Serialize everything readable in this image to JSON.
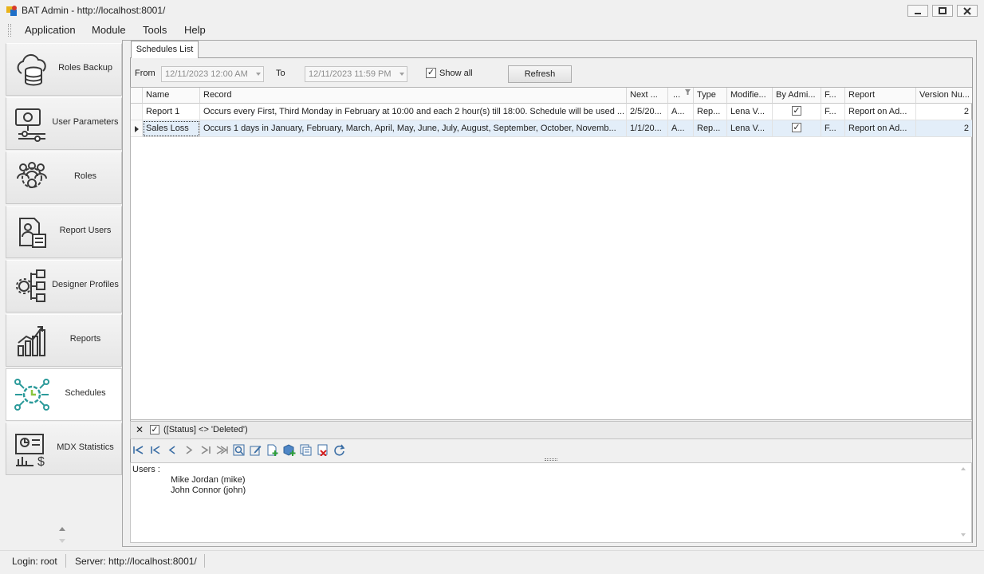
{
  "window": {
    "title": "BAT Admin - http://localhost:8001/"
  },
  "menu": [
    "Application",
    "Module",
    "Tools",
    "Help"
  ],
  "nav": [
    {
      "label": "Roles Backup",
      "icon": "cloud-database-icon"
    },
    {
      "label": "User Parameters",
      "icon": "user-parameters-icon"
    },
    {
      "label": "Roles",
      "icon": "roles-group-icon"
    },
    {
      "label": "Report Users",
      "icon": "report-users-icon"
    },
    {
      "label": "Designer Profiles",
      "icon": "designer-profiles-icon"
    },
    {
      "label": "Reports",
      "icon": "reports-chart-icon"
    },
    {
      "label": "Schedules",
      "icon": "schedules-icon"
    },
    {
      "label": "MDX Statistics",
      "icon": "mdx-statistics-icon"
    }
  ],
  "tab": {
    "label": "Schedules List"
  },
  "filter": {
    "from_label": "From",
    "from_value": "12/11/2023 12:00 AM",
    "to_label": "To",
    "to_value": "12/11/2023 11:59 PM",
    "show_all_label": "Show all",
    "show_all_checked": "✓",
    "refresh_label": "Refresh"
  },
  "grid": {
    "columns": [
      "Name",
      "Record",
      "Next ...",
      "...",
      "Type",
      "Modifie...",
      "By Admi...",
      "F...",
      "Report",
      "Version Nu..."
    ],
    "rows": [
      {
        "name": "Report 1",
        "record": "Occurs every First, Third Monday in February at 10:00 and each 2 hour(s) till 18:00. Schedule will be used ...",
        "next": "2/5/20...",
        "col4": "A...",
        "type": "Rep...",
        "modified": "Lena V...",
        "by_admin": "✓",
        "f": "F...",
        "report": "Report on Ad...",
        "version": "2"
      },
      {
        "name": "Sales Loss",
        "record": "Occurs 1 days in January, February, March, April, May, June, July, August, September, October, Novemb...",
        "next": "1/1/20...",
        "col4": "A...",
        "type": "Rep...",
        "modified": "Lena V...",
        "by_admin": "✓",
        "f": "F...",
        "report": "Report on Ad...",
        "version": "2"
      }
    ]
  },
  "filter_bar": {
    "close": "✕",
    "checked": "✓",
    "expression": "([Status] <> 'Deleted')"
  },
  "detail": {
    "users_label": "Users :",
    "users": [
      "Mike Jordan (mike)",
      "John Connor (john)"
    ]
  },
  "status": {
    "login": "Login: root",
    "server": "Server: http://localhost:8001/"
  },
  "colors": {
    "accent": "#2b9a9a",
    "selection": "#e3eef9",
    "icon": "#3a3a3a"
  }
}
